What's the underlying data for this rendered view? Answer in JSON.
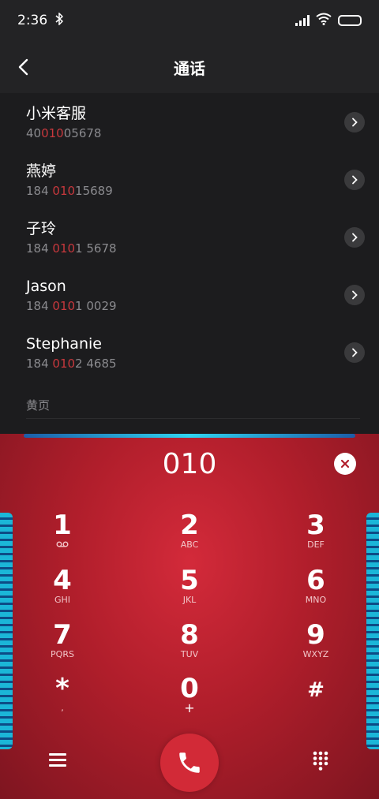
{
  "status_bar": {
    "time": "2:36"
  },
  "header": {
    "title": "通话"
  },
  "results": [
    {
      "name": "小米客服",
      "number_prefix": "40",
      "number_match": "010",
      "number_suffix": "05678"
    },
    {
      "name": "燕婷",
      "number_prefix": "184 ",
      "number_match": "010",
      "number_suffix": "15689"
    },
    {
      "name": "子玲",
      "number_prefix": "184 ",
      "number_match": "010",
      "number_suffix": "1 5678"
    },
    {
      "name": "Jason",
      "number_prefix": "184 ",
      "number_match": "010",
      "number_suffix": "1 0029"
    },
    {
      "name": "Stephanie",
      "number_prefix": "184 ",
      "number_match": "010",
      "number_suffix": "2 4685"
    }
  ],
  "section_label": "黄页",
  "dialpad": {
    "input": "010",
    "keys": [
      {
        "digit": "1",
        "letters": ""
      },
      {
        "digit": "2",
        "letters": "ABC"
      },
      {
        "digit": "3",
        "letters": "DEF"
      },
      {
        "digit": "4",
        "letters": "GHI"
      },
      {
        "digit": "5",
        "letters": "JKL"
      },
      {
        "digit": "6",
        "letters": "MNO"
      },
      {
        "digit": "7",
        "letters": "PQRS"
      },
      {
        "digit": "8",
        "letters": "TUV"
      },
      {
        "digit": "9",
        "letters": "WXYZ"
      },
      {
        "digit": "*",
        "letters": ","
      },
      {
        "digit": "0",
        "letters": "+"
      },
      {
        "digit": "#",
        "letters": ""
      }
    ]
  },
  "colors": {
    "accent": "#c8383d",
    "dialpad_bg": "#b01e2b",
    "call_button": "#d22a37"
  },
  "icons": [
    "bluetooth-icon",
    "signal-icon",
    "wifi-icon",
    "battery-icon",
    "back-icon",
    "chevron-right-icon",
    "clear-icon",
    "voicemail-icon",
    "menu-icon",
    "phone-icon",
    "keypad-icon"
  ]
}
